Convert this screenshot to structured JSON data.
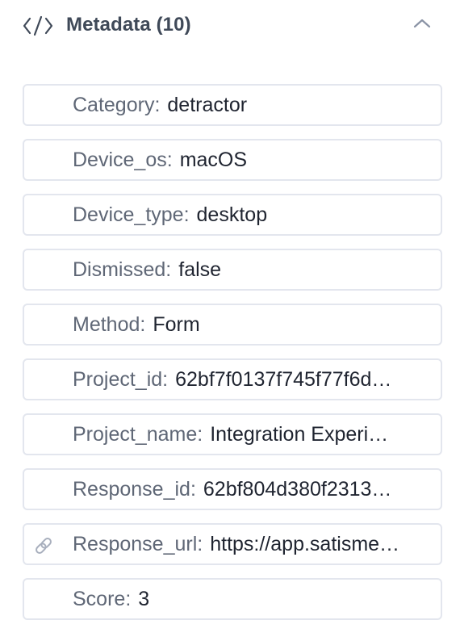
{
  "metadata": {
    "title": "Metadata (10)",
    "icons": {
      "header": "code-icon",
      "collapse": "chevron-up-icon",
      "url_row": "link-icon"
    },
    "colors": {
      "title": "#3f4958",
      "key": "#5f6776",
      "value": "#1f2430",
      "border": "#e3e6ee"
    },
    "items": [
      {
        "key": "Category",
        "sep": ":",
        "value": "detractor"
      },
      {
        "key": "Device_os",
        "sep": ":",
        "value": "macOS"
      },
      {
        "key": "Device_type",
        "sep": ":",
        "value": "desktop"
      },
      {
        "key": "Dismissed",
        "sep": ":",
        "value": "false"
      },
      {
        "key": "Method",
        "sep": ":",
        "value": "Form"
      },
      {
        "key": "Project_id",
        "sep": ":",
        "value": "62bf7f0137f745f77f6d…"
      },
      {
        "key": "Project_name",
        "sep": ":",
        "value": "Integration Experi…"
      },
      {
        "key": "Response_id",
        "sep": ":",
        "value": "62bf804d380f2313…"
      },
      {
        "key": "Response_url",
        "sep": ":",
        "value": "https://app.satisme…"
      },
      {
        "key": "Score",
        "sep": ":",
        "value": "3"
      }
    ]
  }
}
